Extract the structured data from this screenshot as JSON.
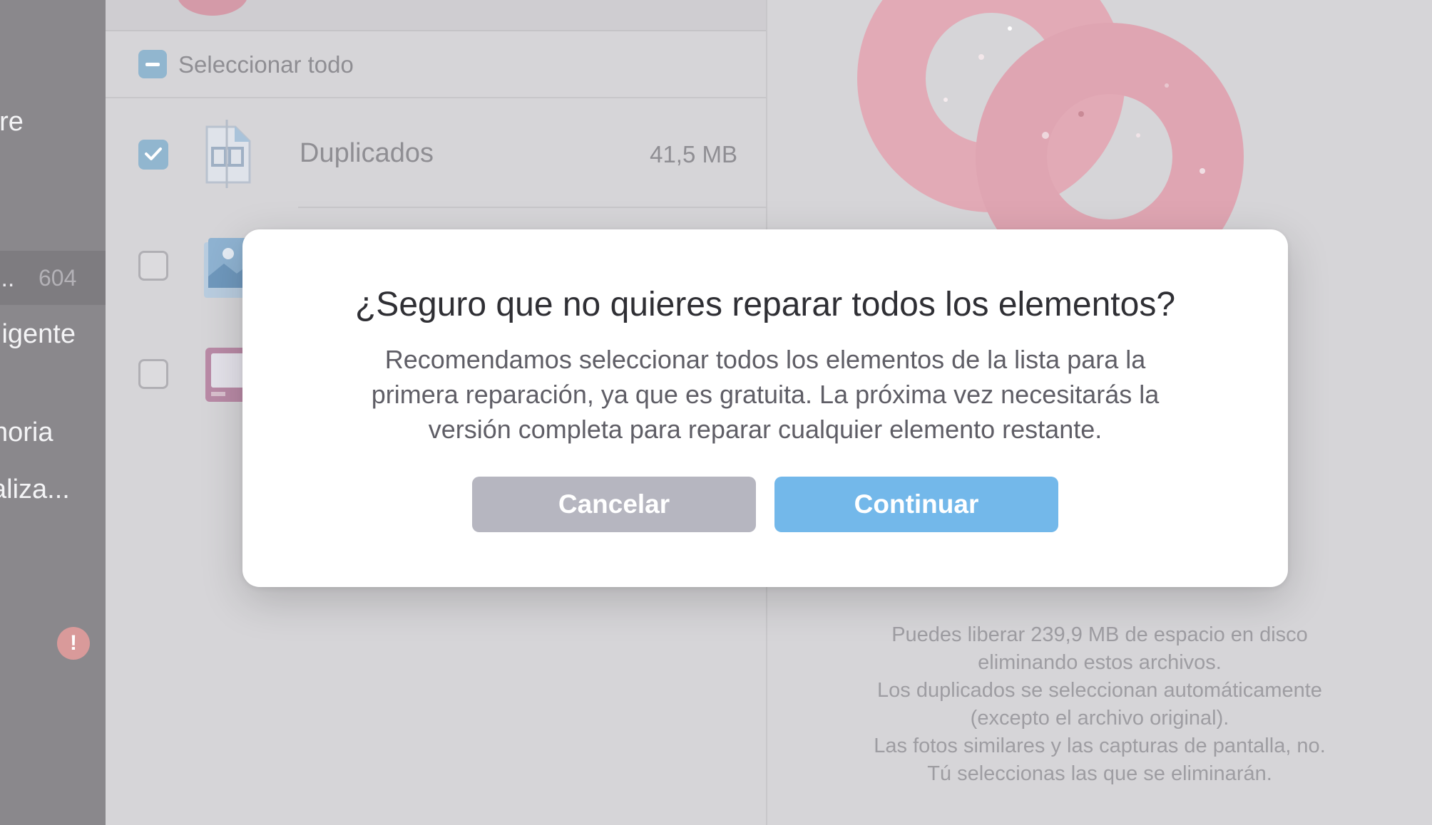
{
  "sidebar": {
    "items": [
      {
        "label": "are"
      },
      {
        "label": "..."
      },
      {
        "label": "ligente"
      },
      {
        "label": "noria"
      },
      {
        "label": "aliza..."
      }
    ],
    "active_count": "604",
    "warning_glyph": "!"
  },
  "list": {
    "select_all_label": "Seleccionar todo",
    "rows": [
      {
        "name": "Duplicados",
        "size": "41,5 MB",
        "checked": true,
        "icon": "duplicates-icon"
      },
      {
        "name": "",
        "size": "",
        "checked": false,
        "icon": "photos-icon"
      },
      {
        "name": "",
        "size": "",
        "checked": false,
        "icon": "screenshots-icon"
      }
    ]
  },
  "info": {
    "lines": [
      "Puedes liberar 239,9 MB de espacio en disco",
      "eliminando estos archivos.",
      "Los duplicados se seleccionan automáticamente",
      "(excepto el archivo original).",
      "Las fotos similares y las capturas de pantalla, no.",
      "Tú seleccionas las que se eliminarán."
    ]
  },
  "dialog": {
    "title": "¿Seguro que no quieres reparar todos los elementos?",
    "body_lines": [
      "Recomendamos seleccionar todos los elementos de la lista para la",
      "primera reparación, ya que es gratuita. La próxima vez necesitarás la",
      "versión completa para reparar cualquier elemento restante."
    ],
    "cancel_label": "Cancelar",
    "continue_label": "Continuar"
  },
  "colors": {
    "accent": "#73b8ea",
    "cancel": "#b6b6c0",
    "checkbox_checked": "#91b6cf",
    "warning": "#d99a9a",
    "donut": "#e2aab6"
  }
}
